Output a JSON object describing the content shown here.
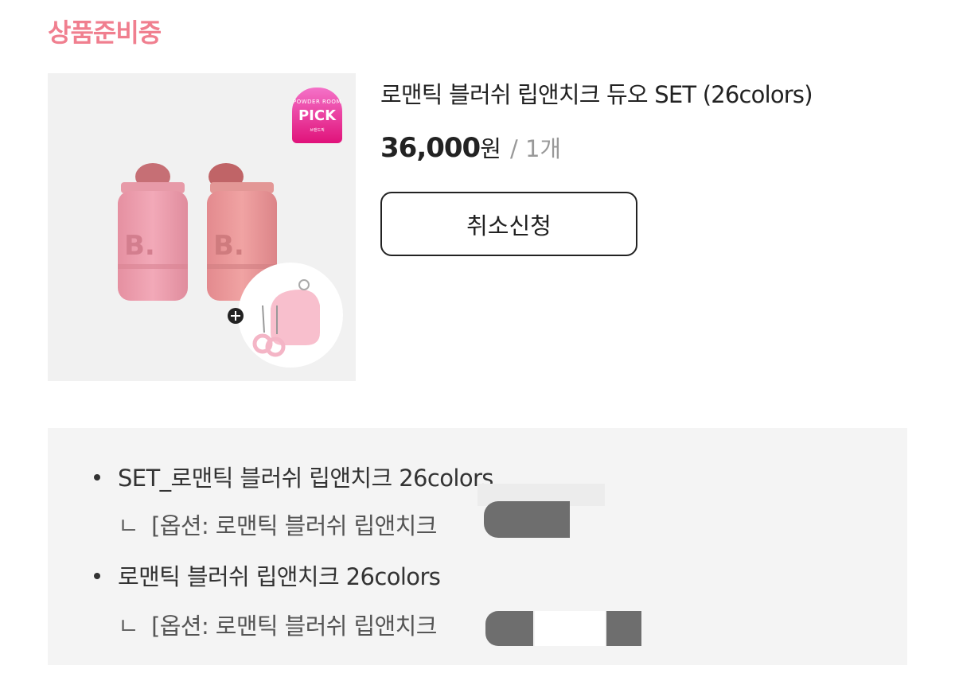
{
  "status": {
    "label": "상품준비중",
    "color": "#f07f8f"
  },
  "product": {
    "title": "로맨틱 블러쉬 립앤치크 듀오 SET (26colors)",
    "price": "36,000",
    "currency": "원",
    "quantity": "/ 1개",
    "image": {
      "badge_top": "POWDER ROOM",
      "badge_main": "PICK",
      "badge_bottom": "브랜드픽",
      "logo_letter": "B."
    }
  },
  "actions": {
    "cancel_label": "취소신청"
  },
  "options": {
    "items": [
      {
        "name": "SET_로맨틱 블러쉬 립앤치크 26colors",
        "sub_mark": "ㄴ",
        "sub": "[옵션: 로맨틱 블러쉬 립앤치크"
      },
      {
        "name": "로맨틱 블러쉬 립앤치크 26colors",
        "sub_mark": "ㄴ",
        "sub": "[옵션: 로맨틱 블러쉬 립앤치크"
      }
    ]
  }
}
